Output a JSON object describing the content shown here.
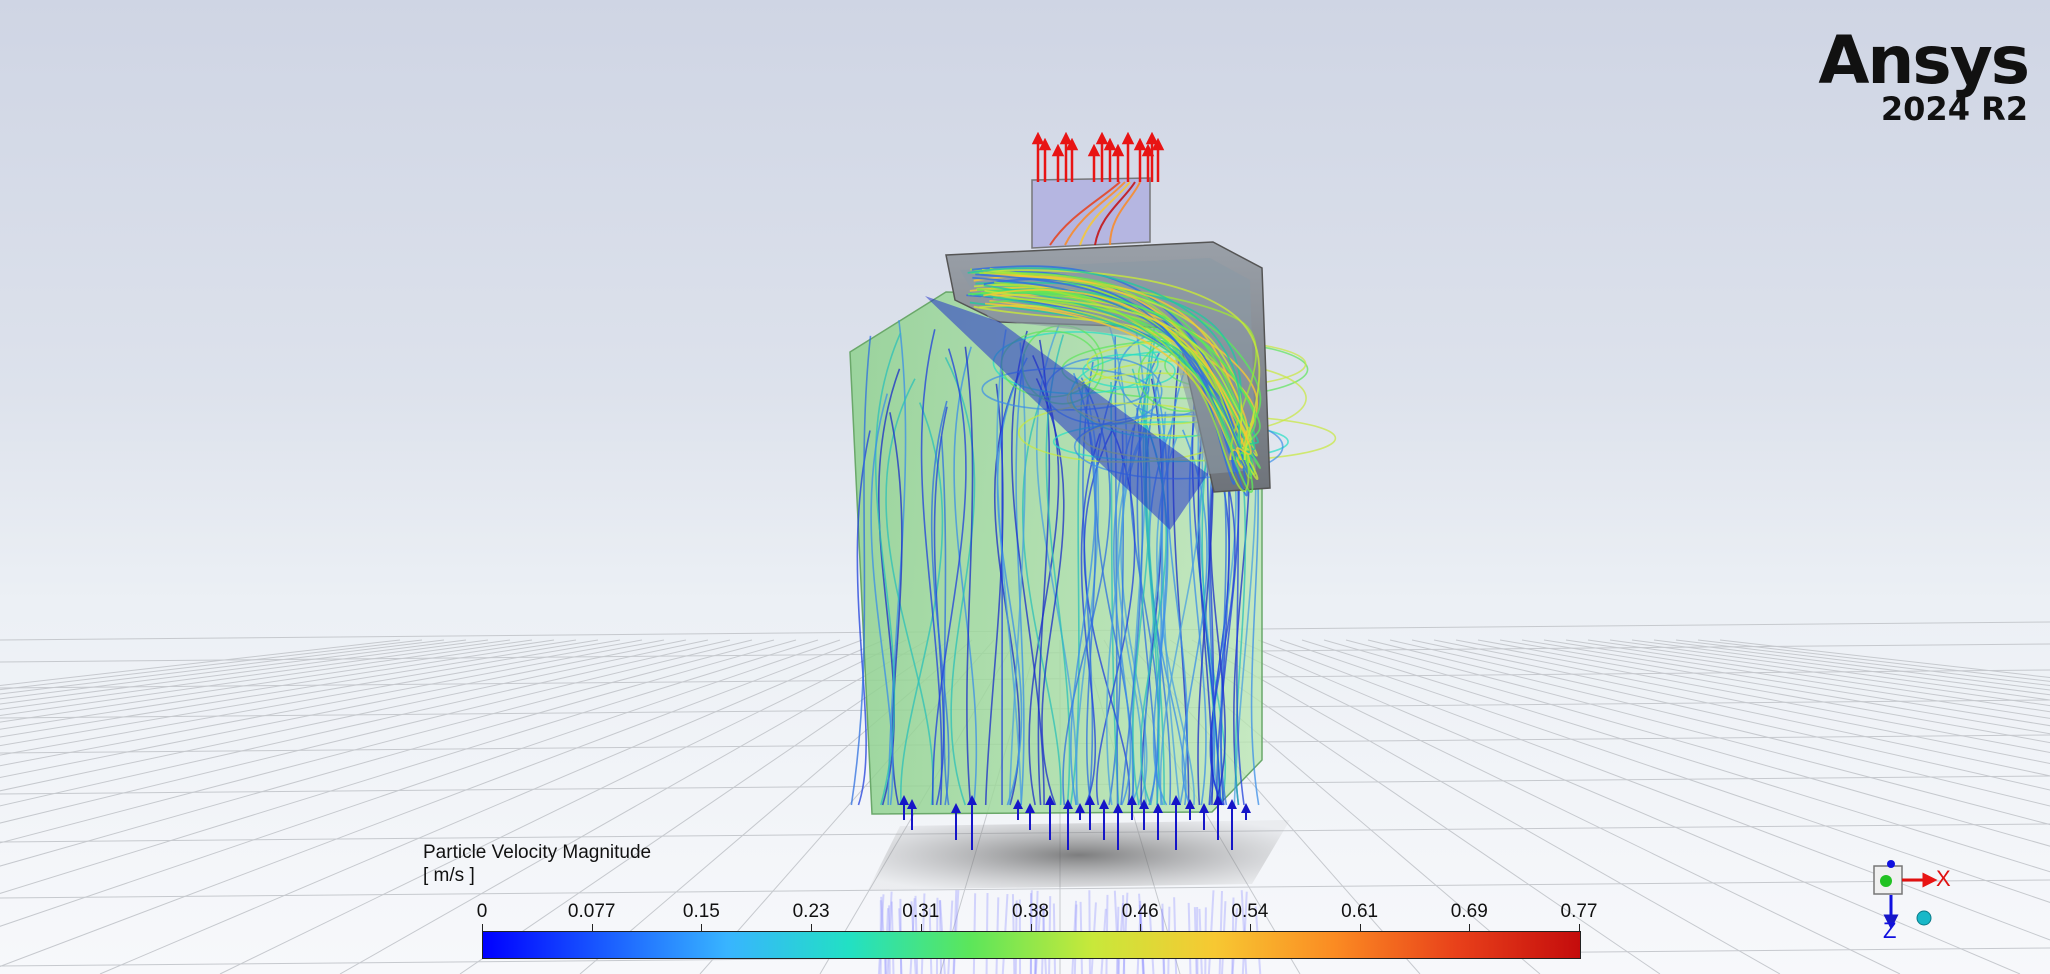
{
  "app": {
    "name": "Ansys",
    "version": "2024 R2"
  },
  "legend": {
    "title": "Particle Velocity Magnitude",
    "unit": "[ m/s ]",
    "ticks": [
      "0",
      "0.077",
      "0.15",
      "0.23",
      "0.31",
      "0.38",
      "0.46",
      "0.54",
      "0.61",
      "0.69",
      "0.77"
    ],
    "colormap": [
      "#0000ff",
      "#1a5cff",
      "#38b4ff",
      "#22e0c4",
      "#5ce65a",
      "#c8e83a",
      "#f7c832",
      "#fb8a22",
      "#e8401a",
      "#c40c0c"
    ]
  },
  "triad": {
    "x_label": "X",
    "z_label": "Z",
    "x_color": "#e01010",
    "z_color": "#1010e0"
  },
  "colors": {
    "inlet_arrows": "#1616c8",
    "outlet_arrows": "#e81414"
  }
}
